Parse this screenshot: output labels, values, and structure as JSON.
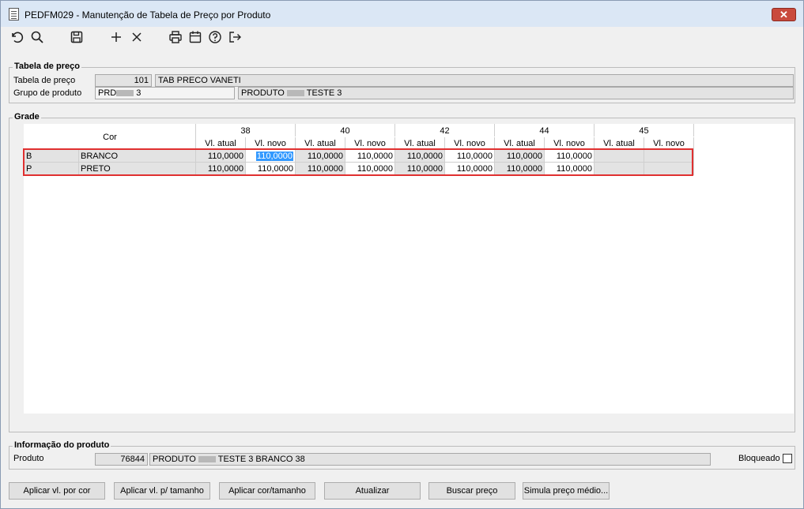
{
  "window": {
    "title": "PEDFM029 - Manutenção de Tabela de Preço por Produto",
    "close_label": "✕"
  },
  "toolbar": {
    "icons": [
      "undo-icon",
      "search-icon",
      "save-icon",
      "add-icon",
      "delete-icon",
      "print-icon",
      "calendar-icon",
      "help-icon",
      "exit-icon"
    ]
  },
  "tabela": {
    "legend": "Tabela de preço",
    "tabela_label": "Tabela de preço",
    "tabela_code": "101",
    "tabela_desc": "TAB PRECO VANETI",
    "grupo_label": "Grupo de produto",
    "grupo_code_prefix": "PRD",
    "grupo_code_suffix": "3",
    "grupo_desc_prefix": "PRODUTO",
    "grupo_desc_suffix": "TESTE 3"
  },
  "grade": {
    "legend": "Grade",
    "cor_header": "Cor",
    "sizes": [
      "38",
      "40",
      "42",
      "44",
      "45"
    ],
    "sub_atual": "Vl. atual",
    "sub_novo": "Vl. novo",
    "rows": [
      {
        "code": "B",
        "name": "BRANCO",
        "values": [
          "110,0000",
          "110,0000",
          "110,0000",
          "110,0000",
          "110,0000",
          "110,0000",
          "110,0000",
          "110,0000",
          "",
          ""
        ]
      },
      {
        "code": "P",
        "name": "PRETO",
        "values": [
          "110,0000",
          "110,0000",
          "110,0000",
          "110,0000",
          "110,0000",
          "110,0000",
          "110,0000",
          "110,0000",
          "",
          ""
        ]
      }
    ]
  },
  "produto": {
    "legend": "Informação do produto",
    "produto_label": "Produto",
    "produto_code": "76844",
    "produto_desc_prefix": "PRODUTO",
    "produto_desc_suffix": "TESTE 3 BRANCO 38",
    "bloqueado_label": "Bloqueado",
    "bloqueado_checked": false
  },
  "buttons": {
    "aplicar_cor": "Aplicar vl. por cor",
    "aplicar_tamanho": "Aplicar vl. p/ tamanho",
    "aplicar_cor_tamanho": "Aplicar cor/tamanho",
    "atualizar": "Atualizar",
    "buscar_preco": "Buscar preço",
    "simula": "Simula preço médio..."
  }
}
